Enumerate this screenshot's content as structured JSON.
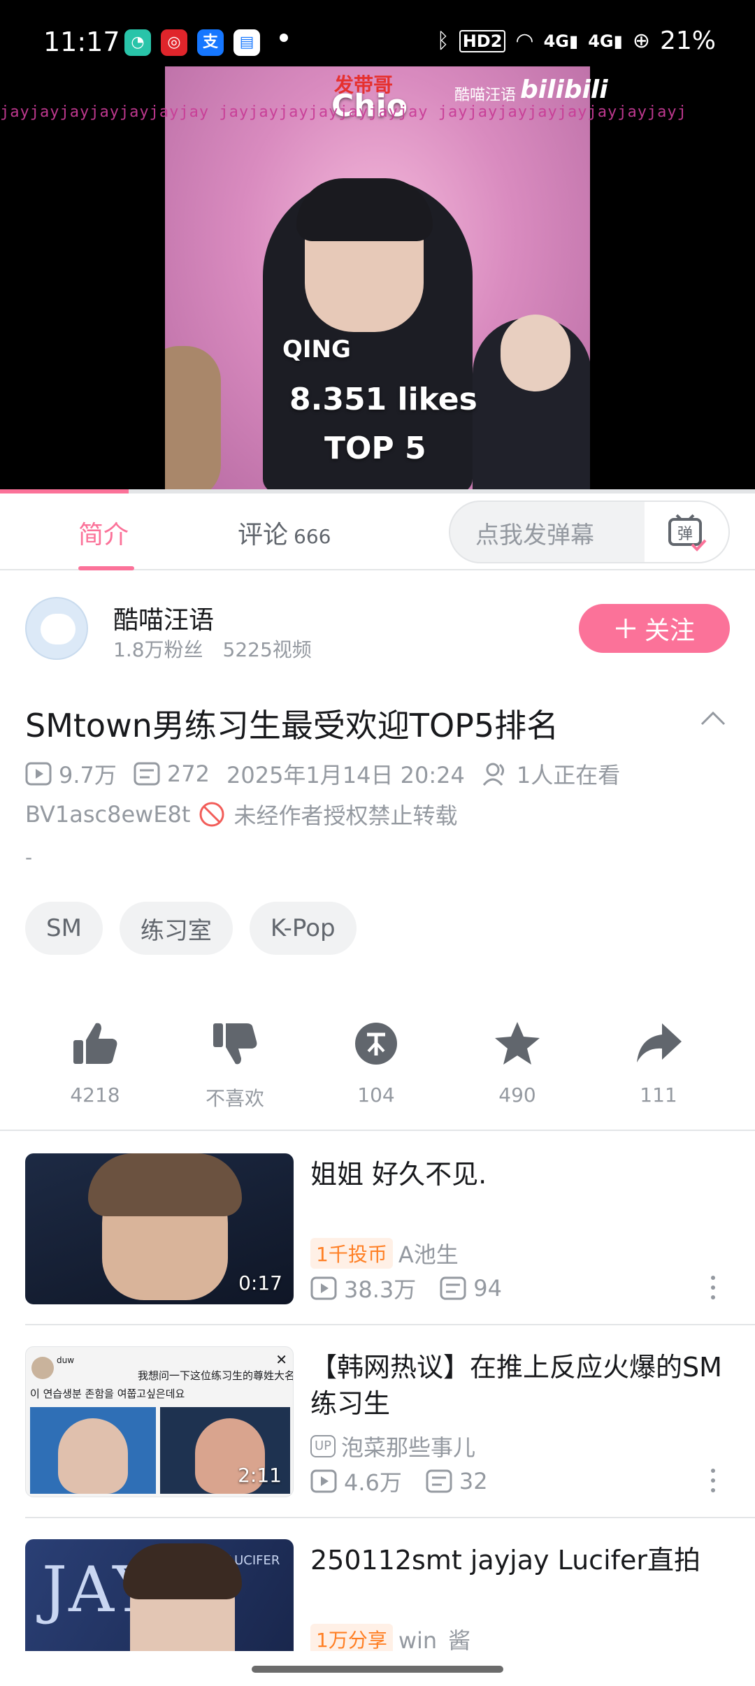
{
  "status_bar": {
    "time": "11:17",
    "battery": "21%",
    "signal_1": "4G",
    "signal_2": "4G",
    "hd": "HD2"
  },
  "video": {
    "overlay_brand": "Chio",
    "overlay_promo": "发带哥",
    "overlay_name": "QING",
    "overlay_likes": "8.351 likes",
    "overlay_rank": "TOP 5",
    "watermark_channel": "酷喵汪语",
    "watermark_logo": "bilibili",
    "watermark_row": "jayjayjayjayjayjayjay  jayjayjayjayjayjayjay  jayjayjayjayjayjayjayjayj",
    "progress": 0.17
  },
  "tabs": {
    "intro": "简介",
    "comments": "评论",
    "comments_count": "666",
    "danmaku_placeholder": "点我发弹幕",
    "danmaku_icon_text": "弹"
  },
  "uploader": {
    "name": "酷喵汪语",
    "fans": "1.8万粉丝",
    "videos": "5225视频",
    "follow": "关注"
  },
  "video_info": {
    "title": "SMtown男练习生最受欢迎TOP5排名",
    "views": "9.7万",
    "danmaku": "272",
    "date": "2025年1月14日 20:24",
    "watching": "1人正在看",
    "bvid": "BV1asc8ewE8t",
    "no_repost": "未经作者授权禁止转载",
    "desc": "-"
  },
  "tags": [
    "SM",
    "练习室",
    "K-Pop"
  ],
  "actions": {
    "like": "4218",
    "dislike": "不喜欢",
    "coin": "104",
    "favorite": "490",
    "share": "111"
  },
  "recommendations": [
    {
      "title": "姐姐 好久不见.",
      "duration": "0:17",
      "badge": "1千投币",
      "author": "A池生",
      "views": "38.3万",
      "danmaku": "94"
    },
    {
      "title": "【韩网热议】在推上反应火爆的SM练习生",
      "duration": "2:11",
      "up_label": "UP",
      "author": "泡菜那些事儿",
      "views": "4.6万",
      "danmaku": "32",
      "thumb_user": "duw",
      "thumb_line1": "我想问一下这位练习生的尊姓大名",
      "thumb_line2": "이 연습생분 존함을 여쭙고싶은데요"
    },
    {
      "title": "250112smt jayjay Lucifer直拍",
      "badge": "1万分享",
      "author": "win_酱",
      "thumb_text": "JAY",
      "thumb_text2": "LUCIFER"
    }
  ],
  "colors": {
    "accent": "#fb7299",
    "text_primary": "#18191c",
    "text_secondary": "#9499a0",
    "badge_orange": "#ff7f24"
  }
}
